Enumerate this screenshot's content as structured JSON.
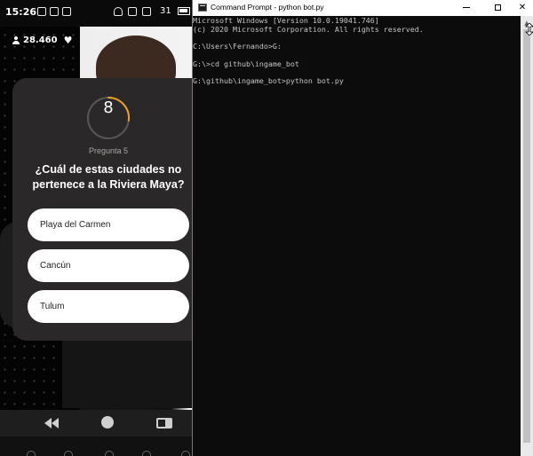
{
  "phone": {
    "status_time": "15:26",
    "battery_text": "31",
    "user_count": "28.460",
    "quiz": {
      "timer": "8",
      "timer_progress": 0.27,
      "question_number": "Pregunta 5",
      "question": "¿Cuál de estas ciudades no pertenece a la Riviera Maya?",
      "answers": [
        "Playa del Carmen",
        "Cancún",
        "Tulum"
      ]
    },
    "icons": {
      "user": "person-icon",
      "like": "heart-icon",
      "back": "back-triangle-icon",
      "home": "home-circle-icon",
      "recents": "recents-square-icon"
    },
    "colors": {
      "card": "#2a2828",
      "timer_arc": "#f0a020"
    }
  },
  "cmd": {
    "title": "Command Prompt - python  bot.py",
    "lines": [
      "Microsoft Windows [Version 10.0.19041.746]",
      "(c) 2020 Microsoft Corporation. All rights reserved.",
      "",
      "C:\\Users\\Fernando>G:",
      "",
      "G:\\>cd github\\ingame_bot",
      "",
      "G:\\github\\ingame_bot>python bot.py"
    ],
    "buttons": {
      "close": "✕"
    },
    "colors": {
      "background": "#0c0c0c",
      "text": "#c5c5c5"
    }
  }
}
